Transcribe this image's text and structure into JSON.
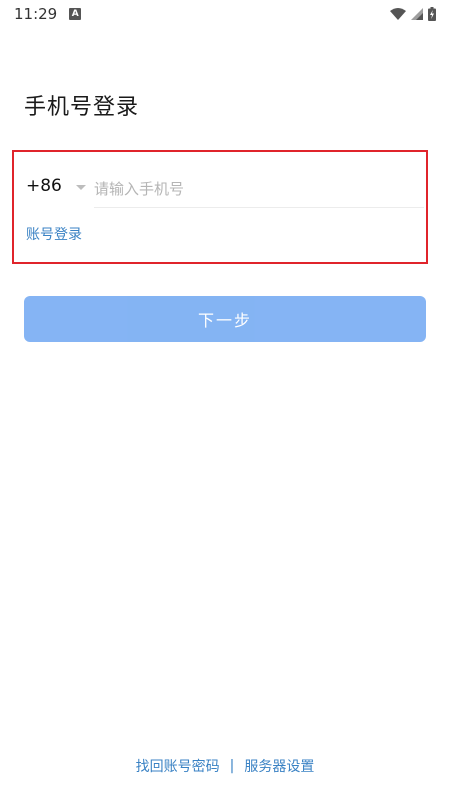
{
  "status_bar": {
    "time": "11:29",
    "notification_icon": "a-icon",
    "wifi_icon": "wifi-icon",
    "signal_icon": "signal-icon",
    "battery_icon": "battery-charging-icon"
  },
  "title": "手机号登录",
  "login": {
    "country_code": "+86",
    "caret_icon": "caret-down-icon",
    "phone_placeholder": "请输入手机号",
    "phone_value": "",
    "account_login_label": "账号登录",
    "highlight_color": "#e0242b"
  },
  "next_button": {
    "label": "下一步",
    "color": "#7eb0f3",
    "enabled": false
  },
  "footer": {
    "recover_label": "找回账号密码",
    "separator": "|",
    "server_settings_label": "服务器设置",
    "link_color": "#3a82c4"
  }
}
